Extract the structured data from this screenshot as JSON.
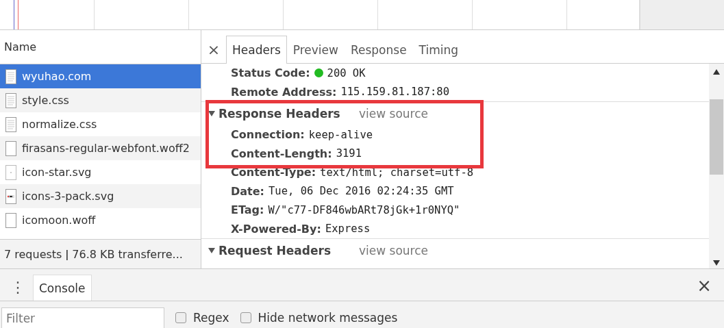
{
  "requests": {
    "header": "Name",
    "items": [
      {
        "name": "wyuhao.com",
        "kind": "document",
        "selected": true
      },
      {
        "name": "style.css",
        "kind": "document",
        "selected": false
      },
      {
        "name": "normalize.css",
        "kind": "document",
        "selected": false
      },
      {
        "name": "firasans-regular-webfont.woff2",
        "kind": "font",
        "selected": false
      },
      {
        "name": "icon-star.svg",
        "kind": "svg",
        "selected": false
      },
      {
        "name": "icons-3-pack.svg",
        "kind": "image",
        "selected": false
      },
      {
        "name": "icomoon.woff",
        "kind": "font",
        "selected": false
      }
    ],
    "summary": "7 requests ǀ 76.8 KB transferre..."
  },
  "detail": {
    "close": "×",
    "tabs": [
      {
        "label": "Headers",
        "selected": true
      },
      {
        "label": "Preview",
        "selected": false
      },
      {
        "label": "Response",
        "selected": false
      },
      {
        "label": "Timing",
        "selected": false
      }
    ],
    "general": [
      {
        "key": "Status Code:",
        "value": "200 OK",
        "color": "#22bb22"
      },
      {
        "key": "Remote Address:",
        "value": "115.159.81.187:80"
      }
    ],
    "sections": [
      {
        "title": "Response Headers",
        "link": "view source",
        "expanded": true,
        "headers": [
          {
            "key": "Connection:",
            "value": "keep-alive"
          },
          {
            "key": "Content-Length:",
            "value": "3191"
          },
          {
            "key": "Content-Type:",
            "value": "text/html; charset=utf-8"
          },
          {
            "key": "Date:",
            "value": "Tue, 06 Dec 2016 02:24:35 GMT"
          },
          {
            "key": "ETag:",
            "value": "W/\"c77-DF846wbARt78jGk+1r0NYQ\""
          },
          {
            "key": "X-Powered-By:",
            "value": "Express"
          }
        ]
      },
      {
        "title": "Request Headers",
        "link": "view source",
        "expanded": true
      }
    ]
  },
  "drawer": {
    "menu": "⋮",
    "tabs": [
      {
        "label": "Console",
        "selected": true
      }
    ],
    "close": "×",
    "filter": {
      "placeholder": "Filter"
    },
    "options": [
      {
        "label": "Regex",
        "checked": false
      },
      {
        "label": "Hide network messages",
        "checked": false
      }
    ]
  }
}
